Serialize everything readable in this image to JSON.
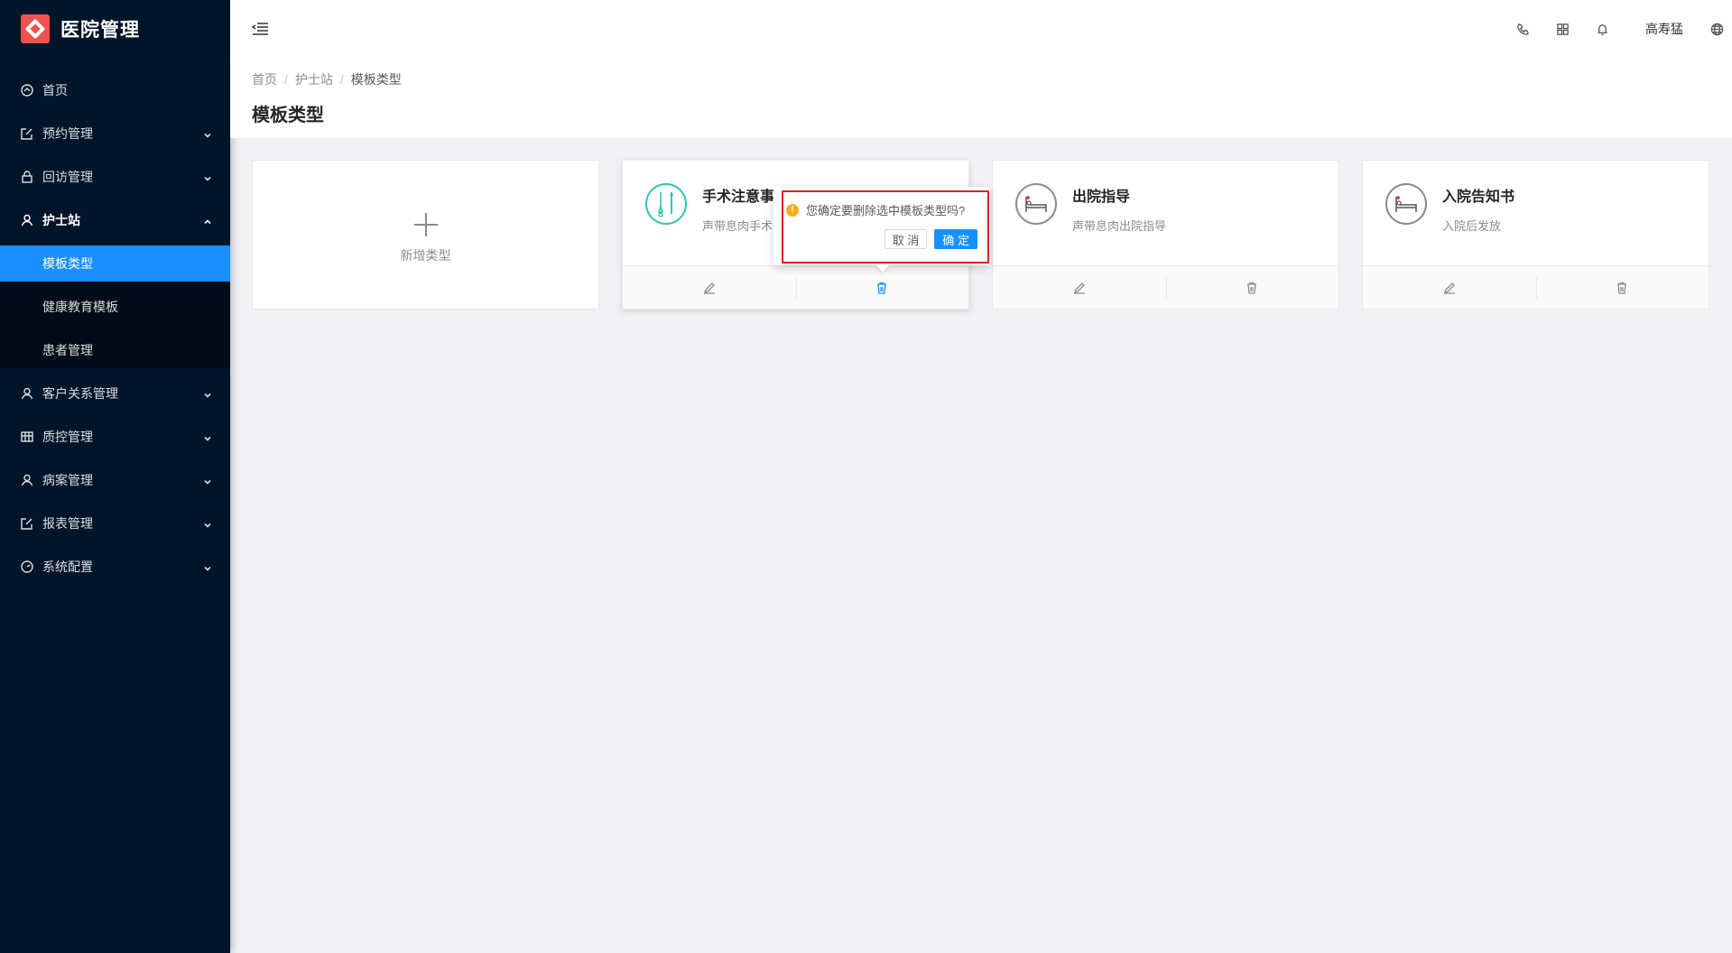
{
  "app": {
    "title": "医院管理"
  },
  "sidebar": {
    "items": [
      {
        "label": "首页",
        "icon": "dashboard-icon",
        "expandable": false
      },
      {
        "label": "预约管理",
        "icon": "edit-icon",
        "expandable": true
      },
      {
        "label": "回访管理",
        "icon": "lock-icon",
        "expandable": true
      },
      {
        "label": "护士站",
        "icon": "user-icon",
        "expandable": true,
        "open": true,
        "children": [
          {
            "label": "模板类型",
            "active": true
          },
          {
            "label": "健康教育模板"
          },
          {
            "label": "患者管理"
          }
        ]
      },
      {
        "label": "客户关系管理",
        "icon": "user-icon",
        "expandable": true
      },
      {
        "label": "质控管理",
        "icon": "table-icon",
        "expandable": true
      },
      {
        "label": "病案管理",
        "icon": "user-icon",
        "expandable": true
      },
      {
        "label": "报表管理",
        "icon": "edit-icon",
        "expandable": true
      },
      {
        "label": "系统配置",
        "icon": "dashboard-icon",
        "expandable": true
      }
    ]
  },
  "header": {
    "username": "高寿猛",
    "icons": [
      "phone-icon",
      "apps-icon",
      "bell-icon",
      "globe-icon"
    ]
  },
  "breadcrumb": [
    "首页",
    "护士站",
    "模板类型"
  ],
  "page": {
    "title": "模板类型"
  },
  "add_card": {
    "label": "新增类型"
  },
  "cards": [
    {
      "title": "手术注意事项",
      "desc": "声带息肉手术",
      "avatar": "surgery-tools-icon"
    },
    {
      "title": "出院指导",
      "desc": "声带息肉出院指导",
      "avatar": "hospital-bed-icon"
    },
    {
      "title": "入院告知书",
      "desc": "入院后发放",
      "avatar": "hospital-bed-icon"
    }
  ],
  "popconfirm": {
    "message": "您确定要删除选中模板类型吗?",
    "cancel": "取 消",
    "ok": "确 定"
  },
  "colors": {
    "sidebar_bg": "#001529",
    "primary": "#1890ff",
    "logo": "#f0524d",
    "warning": "#faad14",
    "highlight_box": "#e02020"
  }
}
